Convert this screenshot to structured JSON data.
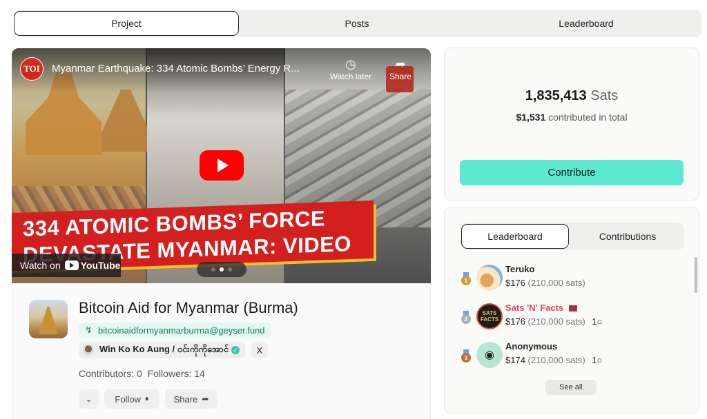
{
  "top_tabs": [
    {
      "label": "Project",
      "active": true
    },
    {
      "label": "Posts",
      "active": false
    },
    {
      "label": "Leaderboard",
      "active": false
    }
  ],
  "video": {
    "channel_logo_text": "TOI",
    "title": "Myanmar Earthquake: 334 Atomic Bombs’ Energy R...",
    "watch_later_label": "Watch later",
    "share_label": "Share",
    "headline_line1": "334 ATOMIC BOMBS’ FORCE",
    "headline_line2": "DEVASTATE MYANMAR: VIDEO",
    "watch_on_label": "Watch on",
    "youtube_label": "YouTube"
  },
  "project": {
    "title": "Bitcoin Aid for Myanmar (Burma)",
    "lightning_address": "bitcoinaidformyanmarburma@geyser.fund",
    "creator_name": "Win Ko Ko Aung / ဝင်းကိုကိုအောင်",
    "x_icon": "X",
    "contributors_label": "Contributors: 0",
    "followers_label": "Followers: 14",
    "follow_label": "Follow",
    "share_label": "Share"
  },
  "funding": {
    "sats_amount": "1,835,413",
    "sats_unit": "Sats",
    "usd_amount": "$1,531",
    "usd_suffix": "contributed in total",
    "contribute_label": "Contribute"
  },
  "leaderboard_tabs": [
    {
      "label": "Leaderboard",
      "active": true
    },
    {
      "label": "Contributions",
      "active": false
    }
  ],
  "leaderboard": [
    {
      "rank": "1",
      "name": "Teruko",
      "amount": "$176",
      "sats": "(210,000 sats)",
      "comments": "",
      "name_color": "#222222",
      "medal_color": "#d29a3a"
    },
    {
      "rank": "2",
      "name": "Sats 'N' Facts",
      "amount": "$176",
      "sats": "(210,000 sats)",
      "comments": "1",
      "name_color": "#d9485f",
      "medal_color": "#a8b0b8"
    },
    {
      "rank": "3",
      "name": "Anonymous",
      "amount": "$174",
      "sats": "(210,000 sats)",
      "comments": "1",
      "name_color": "#222222",
      "medal_color": "#b8713c"
    }
  ],
  "see_all_label": "See all",
  "colors": {
    "accent": "#5ce8d3",
    "lightning_bg": "#e4f7f1",
    "lightning_text": "#157a66",
    "youtube_red": "#ff0000",
    "banner_red": "#d3201f"
  }
}
